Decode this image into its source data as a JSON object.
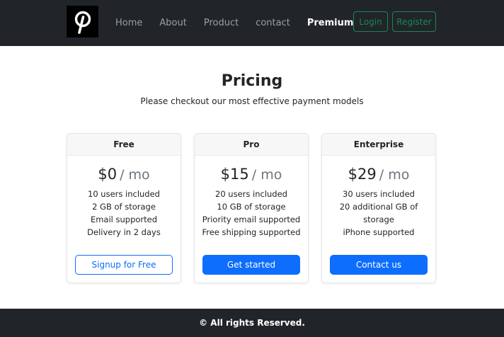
{
  "navbar": {
    "logo_icon": "pinterest-logo",
    "links": [
      {
        "label": "Home"
      },
      {
        "label": "About"
      },
      {
        "label": "Product"
      },
      {
        "label": "contact"
      },
      {
        "label": "Premium",
        "active": true
      }
    ],
    "login_label": "Login",
    "register_label": "Register",
    "accent_color": "#198754"
  },
  "main": {
    "title": "Pricing",
    "subtitle": "Please checkout our most effective payment models"
  },
  "plans": [
    {
      "name": "Free",
      "price": "$0",
      "period": "/ mo",
      "features": [
        "10 users included",
        "2 GB of storage",
        "Email supported",
        "Delivery in 2 days"
      ],
      "button_label": "Signup for Free",
      "button_style": "outline"
    },
    {
      "name": "Pro",
      "price": "$15",
      "period": "/ mo",
      "features": [
        "20 users included",
        "10 GB of storage",
        "Priority email supported",
        "Free shipping supported"
      ],
      "button_label": "Get started",
      "button_style": "solid"
    },
    {
      "name": "Enterprise",
      "price": "$29",
      "period": "/ mo",
      "features": [
        "30 users included",
        "20 additional GB of storage",
        "iPhone supported"
      ],
      "button_label": "Contact us",
      "button_style": "solid"
    }
  ],
  "footer": {
    "text": "© All rights Reserved."
  },
  "colors": {
    "primary": "#0d6efd",
    "dark": "#212529",
    "success": "#198754"
  }
}
